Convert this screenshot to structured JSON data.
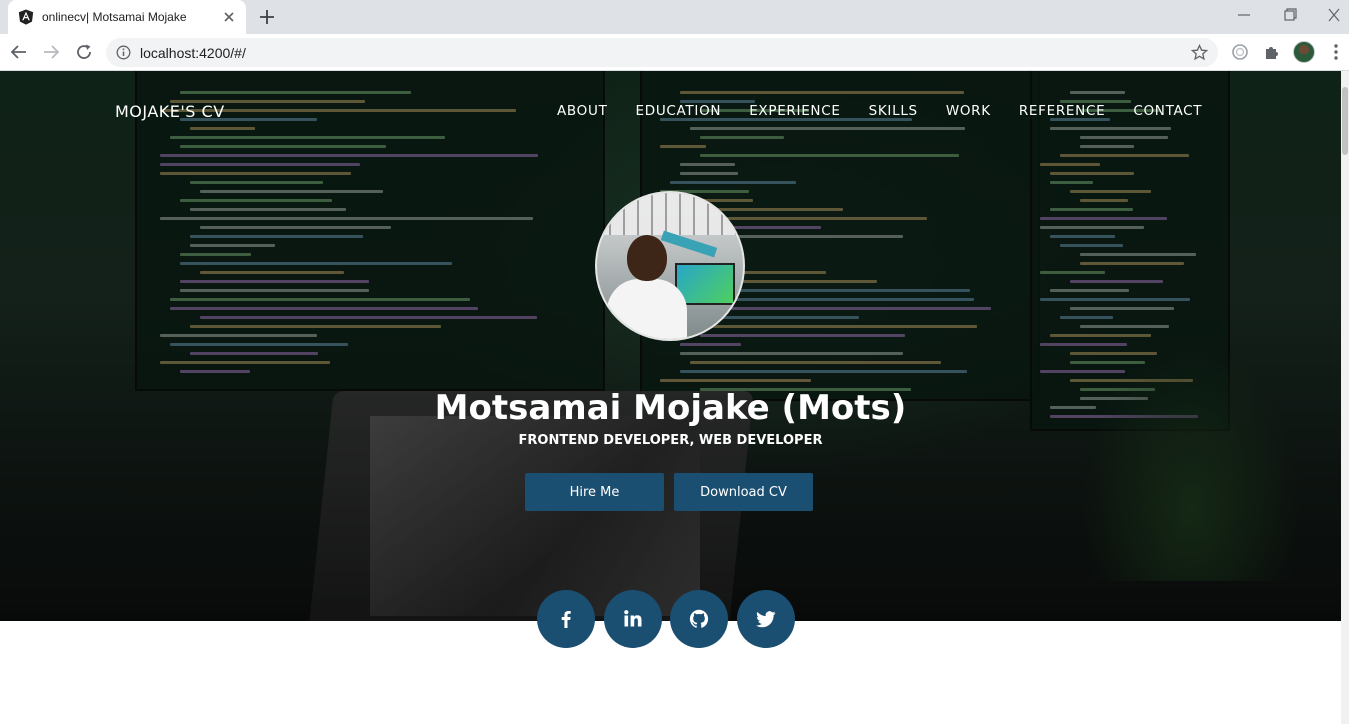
{
  "browser": {
    "tab_title": "onlinecv| Motsamai Mojake",
    "url": "localhost:4200/#/",
    "favicon": "angular-icon"
  },
  "colors": {
    "accent": "#1b4f72",
    "hero_tint": "#153020",
    "text_on_hero": "#ffffff"
  },
  "header": {
    "brand": "MOJAKE'S CV",
    "nav": [
      "ABOUT",
      "EDUCATION",
      "EXPERIENCE",
      "SKILLS",
      "WORK",
      "REFERENCE",
      "CONTACT"
    ]
  },
  "hero": {
    "name": "Motsamai Mojake (Mots)",
    "subtitle": "FRONTEND DEVELOPER, WEB DEVELOPER",
    "buttons": {
      "hire": "Hire Me",
      "download": "Download CV"
    }
  },
  "social": [
    "facebook-icon",
    "linkedin-icon",
    "github-icon",
    "twitter-icon"
  ]
}
